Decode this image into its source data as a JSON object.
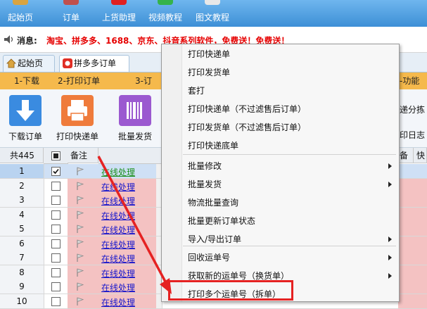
{
  "topbar": {
    "items": [
      {
        "label": "起始页",
        "icon": "home-icon"
      },
      {
        "label": "订单",
        "icon": "cart-icon"
      },
      {
        "label": "上货助理",
        "icon": "upload-icon"
      },
      {
        "label": "视频教程",
        "icon": "chat-icon"
      },
      {
        "label": "图文教程",
        "icon": "doc-icon"
      }
    ]
  },
  "message": {
    "label": "消息:",
    "text": "淘宝、拼多多、1688、京东、抖音系列软件，免费送！免费送！"
  },
  "tabs": [
    {
      "label": "起始页"
    },
    {
      "label": "拼多多订单"
    }
  ],
  "steps": [
    "1-下载",
    "2-打印订单",
    "3-订",
    "-功能"
  ],
  "toolbar": {
    "buttons": [
      {
        "label": "下载订单",
        "icon": "download-arrow-icon"
      },
      {
        "label": "打印快递单",
        "icon": "printer-icon"
      },
      {
        "label": "批量发货",
        "icon": "barcode-icon"
      }
    ],
    "right_fragments": [
      "递分拣",
      "印日志"
    ]
  },
  "grid": {
    "count_label": "共445",
    "remark_header": "备注",
    "right_headers": [
      "备",
      "快"
    ],
    "link_text": "在线处理",
    "rows": [
      "1",
      "2",
      "3",
      "4",
      "5",
      "6",
      "7",
      "8",
      "9",
      "10"
    ]
  },
  "context_menu": {
    "items": [
      {
        "label": "打印快递单",
        "has_submenu": false
      },
      {
        "label": "打印发货单",
        "has_submenu": false
      },
      {
        "label": "套打",
        "has_submenu": false
      },
      {
        "label": "打印快递单（不过滤售后订单）",
        "has_submenu": false
      },
      {
        "label": "打印发货单（不过滤售后订单）",
        "has_submenu": false
      },
      {
        "label": "打印快递底单",
        "has_submenu": false
      },
      {
        "label": "批量修改",
        "has_submenu": true
      },
      {
        "label": "批量发货",
        "has_submenu": true
      },
      {
        "label": "物流批量查询",
        "has_submenu": false
      },
      {
        "label": "批量更新订单状态",
        "has_submenu": false
      },
      {
        "label": "导入/导出订单",
        "has_submenu": true
      },
      {
        "label": "回收运单号",
        "has_submenu": true
      },
      {
        "label": "获取新的运单号（换货单）",
        "has_submenu": true
      },
      {
        "label": "打印多个运单号（拆单）",
        "has_submenu": false
      }
    ]
  },
  "colors": {
    "accent_blue": "#3d8fd6",
    "step_orange": "#f5b94c",
    "alert_red": "#e60000",
    "selected_row": "#cfe0f5",
    "pink_cell": "#f4c2c2",
    "annotation_red": "#e52222"
  }
}
